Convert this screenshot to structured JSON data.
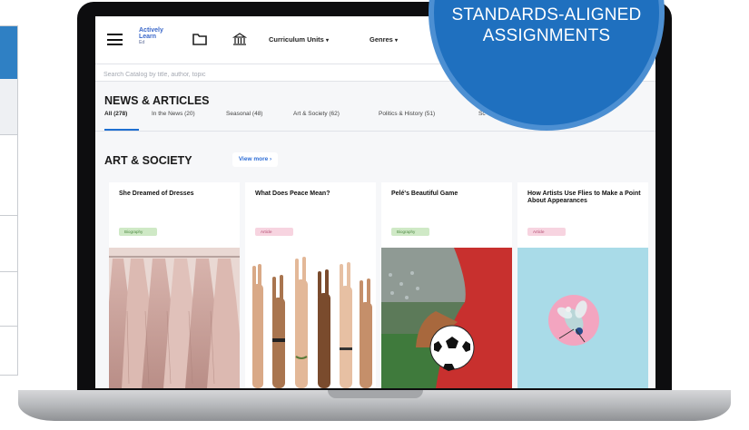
{
  "promo": {
    "line1": "STANDARDS-ALIGNED",
    "line2": "ASSIGNMENTS"
  },
  "app": {
    "logo_line1": "Actively",
    "logo_line2": "Learn",
    "logo_sub": "Ed"
  },
  "nav": {
    "links": [
      {
        "label": "Curriculum Units",
        "caret": "▾"
      },
      {
        "label": "Genres",
        "caret": "▾"
      }
    ]
  },
  "search": {
    "placeholder": "Search Catalog by title, author, topic"
  },
  "news": {
    "title": "NEWS & ARTICLES",
    "tabs": [
      {
        "label": "All (278)"
      },
      {
        "label": "In the News (20)"
      },
      {
        "label": "Seasonal (48)"
      },
      {
        "label": "Art & Society (62)"
      },
      {
        "label": "Politics & History (51)"
      },
      {
        "label": "Sc"
      }
    ]
  },
  "section": {
    "title": "ART & SOCIETY",
    "view_more": "View more ›"
  },
  "cards": [
    {
      "title": "She Dreamed of Dresses",
      "tag": "Biography",
      "tag_color": "#cfe9c6",
      "tag_text_color": "#4f8a44"
    },
    {
      "title": "What Does Peace Mean?",
      "tag": "Article",
      "tag_color": "#f7d4e0",
      "tag_text_color": "#b24a70"
    },
    {
      "title": "Pelé's Beautiful Game",
      "tag": "Biography",
      "tag_color": "#cfe9c6",
      "tag_text_color": "#4f8a44"
    },
    {
      "title": "How Artists Use Flies to Make a Point About Appearances",
      "tag": "Article",
      "tag_color": "#f7d4e0",
      "tag_text_color": "#b24a70"
    }
  ],
  "colors": {
    "accent": "#1f70bf",
    "link": "#2f6ed6"
  }
}
